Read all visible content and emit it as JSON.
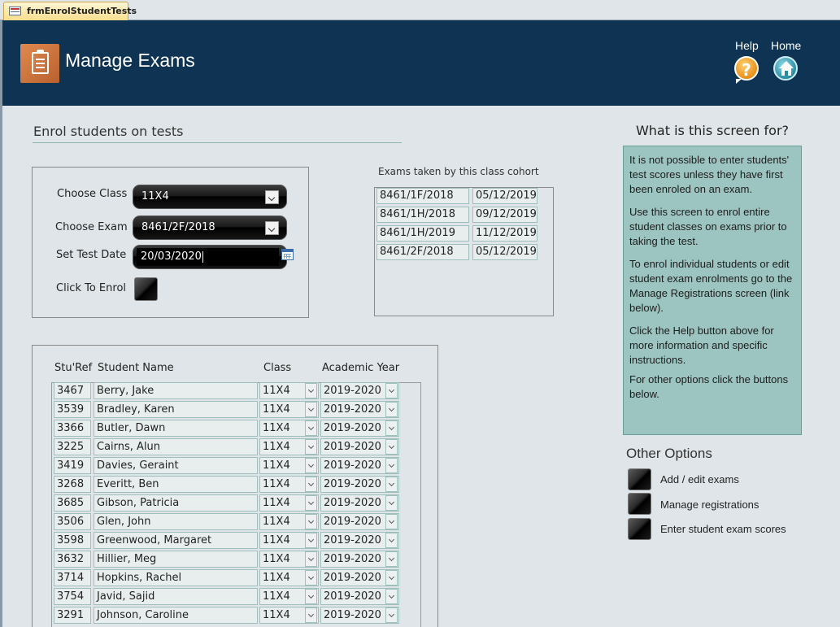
{
  "tab": {
    "title": "frmEnrolStudentTests",
    "icon": "form-icon"
  },
  "header": {
    "title": "Manage Exams",
    "logo_icon": "clipboard-icon",
    "help_label": "Help",
    "help_icon": "question-mark-icon",
    "home_label": "Home",
    "home_icon": "home-icon",
    "background": "#0f3453"
  },
  "enrol": {
    "heading": "Enrol students on tests",
    "class_label": "Choose Class",
    "class_value": "11X4",
    "exam_label": "Choose Exam",
    "exam_value": "8461/2F/2018",
    "date_label": "Set Test Date",
    "date_value": "20/03/2020",
    "enrol_label": "Click To Enrol"
  },
  "exams_taken": {
    "label": "Exams taken by this class cohort",
    "rows": [
      {
        "exam": "8461/1F/2018",
        "date": "05/12/2019"
      },
      {
        "exam": "8461/1H/2018",
        "date": "09/12/2019"
      },
      {
        "exam": "8461/1H/2019",
        "date": "11/12/2019"
      },
      {
        "exam": "8461/2F/2018",
        "date": "05/12/2019"
      }
    ]
  },
  "students": {
    "headers": {
      "ref": "Stu'Ref",
      "name": "Student Name",
      "class": "Class",
      "year": "Academic Year"
    },
    "rows": [
      {
        "ref": "3467",
        "name": "Berry, Jake",
        "class": "11X4",
        "year": "2019-2020"
      },
      {
        "ref": "3539",
        "name": "Bradley, Karen",
        "class": "11X4",
        "year": "2019-2020"
      },
      {
        "ref": "3366",
        "name": "Butler, Dawn",
        "class": "11X4",
        "year": "2019-2020"
      },
      {
        "ref": "3225",
        "name": "Cairns, Alun",
        "class": "11X4",
        "year": "2019-2020"
      },
      {
        "ref": "3419",
        "name": "Davies, Geraint",
        "class": "11X4",
        "year": "2019-2020"
      },
      {
        "ref": "3268",
        "name": "Everitt, Ben",
        "class": "11X4",
        "year": "2019-2020"
      },
      {
        "ref": "3685",
        "name": "Gibson, Patricia",
        "class": "11X4",
        "year": "2019-2020"
      },
      {
        "ref": "3506",
        "name": "Glen, John",
        "class": "11X4",
        "year": "2019-2020"
      },
      {
        "ref": "3598",
        "name": "Greenwood, Margaret",
        "class": "11X4",
        "year": "2019-2020"
      },
      {
        "ref": "3632",
        "name": "Hillier, Meg",
        "class": "11X4",
        "year": "2019-2020"
      },
      {
        "ref": "3714",
        "name": "Hopkins, Rachel",
        "class": "11X4",
        "year": "2019-2020"
      },
      {
        "ref": "3754",
        "name": "Javid, Sajid",
        "class": "11X4",
        "year": "2019-2020"
      },
      {
        "ref": "3291",
        "name": "Johnson, Caroline",
        "class": "11X4",
        "year": "2019-2020"
      }
    ]
  },
  "info": {
    "heading": "What is this screen for?",
    "paragraphs": [
      "It is not possible to enter students' test scores unless they have first been enroled on an exam.",
      "Use this screen to enrol entire student classes on exams prior to taking the test.",
      "To enrol individual students or edit student exam enrolments go to the Manage Registrations screen (link below).",
      "Click the Help button above for more information and specific instructions.",
      "For other options click the buttons below."
    ],
    "background": "#9cc4c0"
  },
  "other_options": {
    "heading": "Other Options",
    "items": [
      {
        "label": "Add / edit exams"
      },
      {
        "label": "Manage registrations"
      },
      {
        "label": "Enter student exam scores"
      }
    ]
  }
}
